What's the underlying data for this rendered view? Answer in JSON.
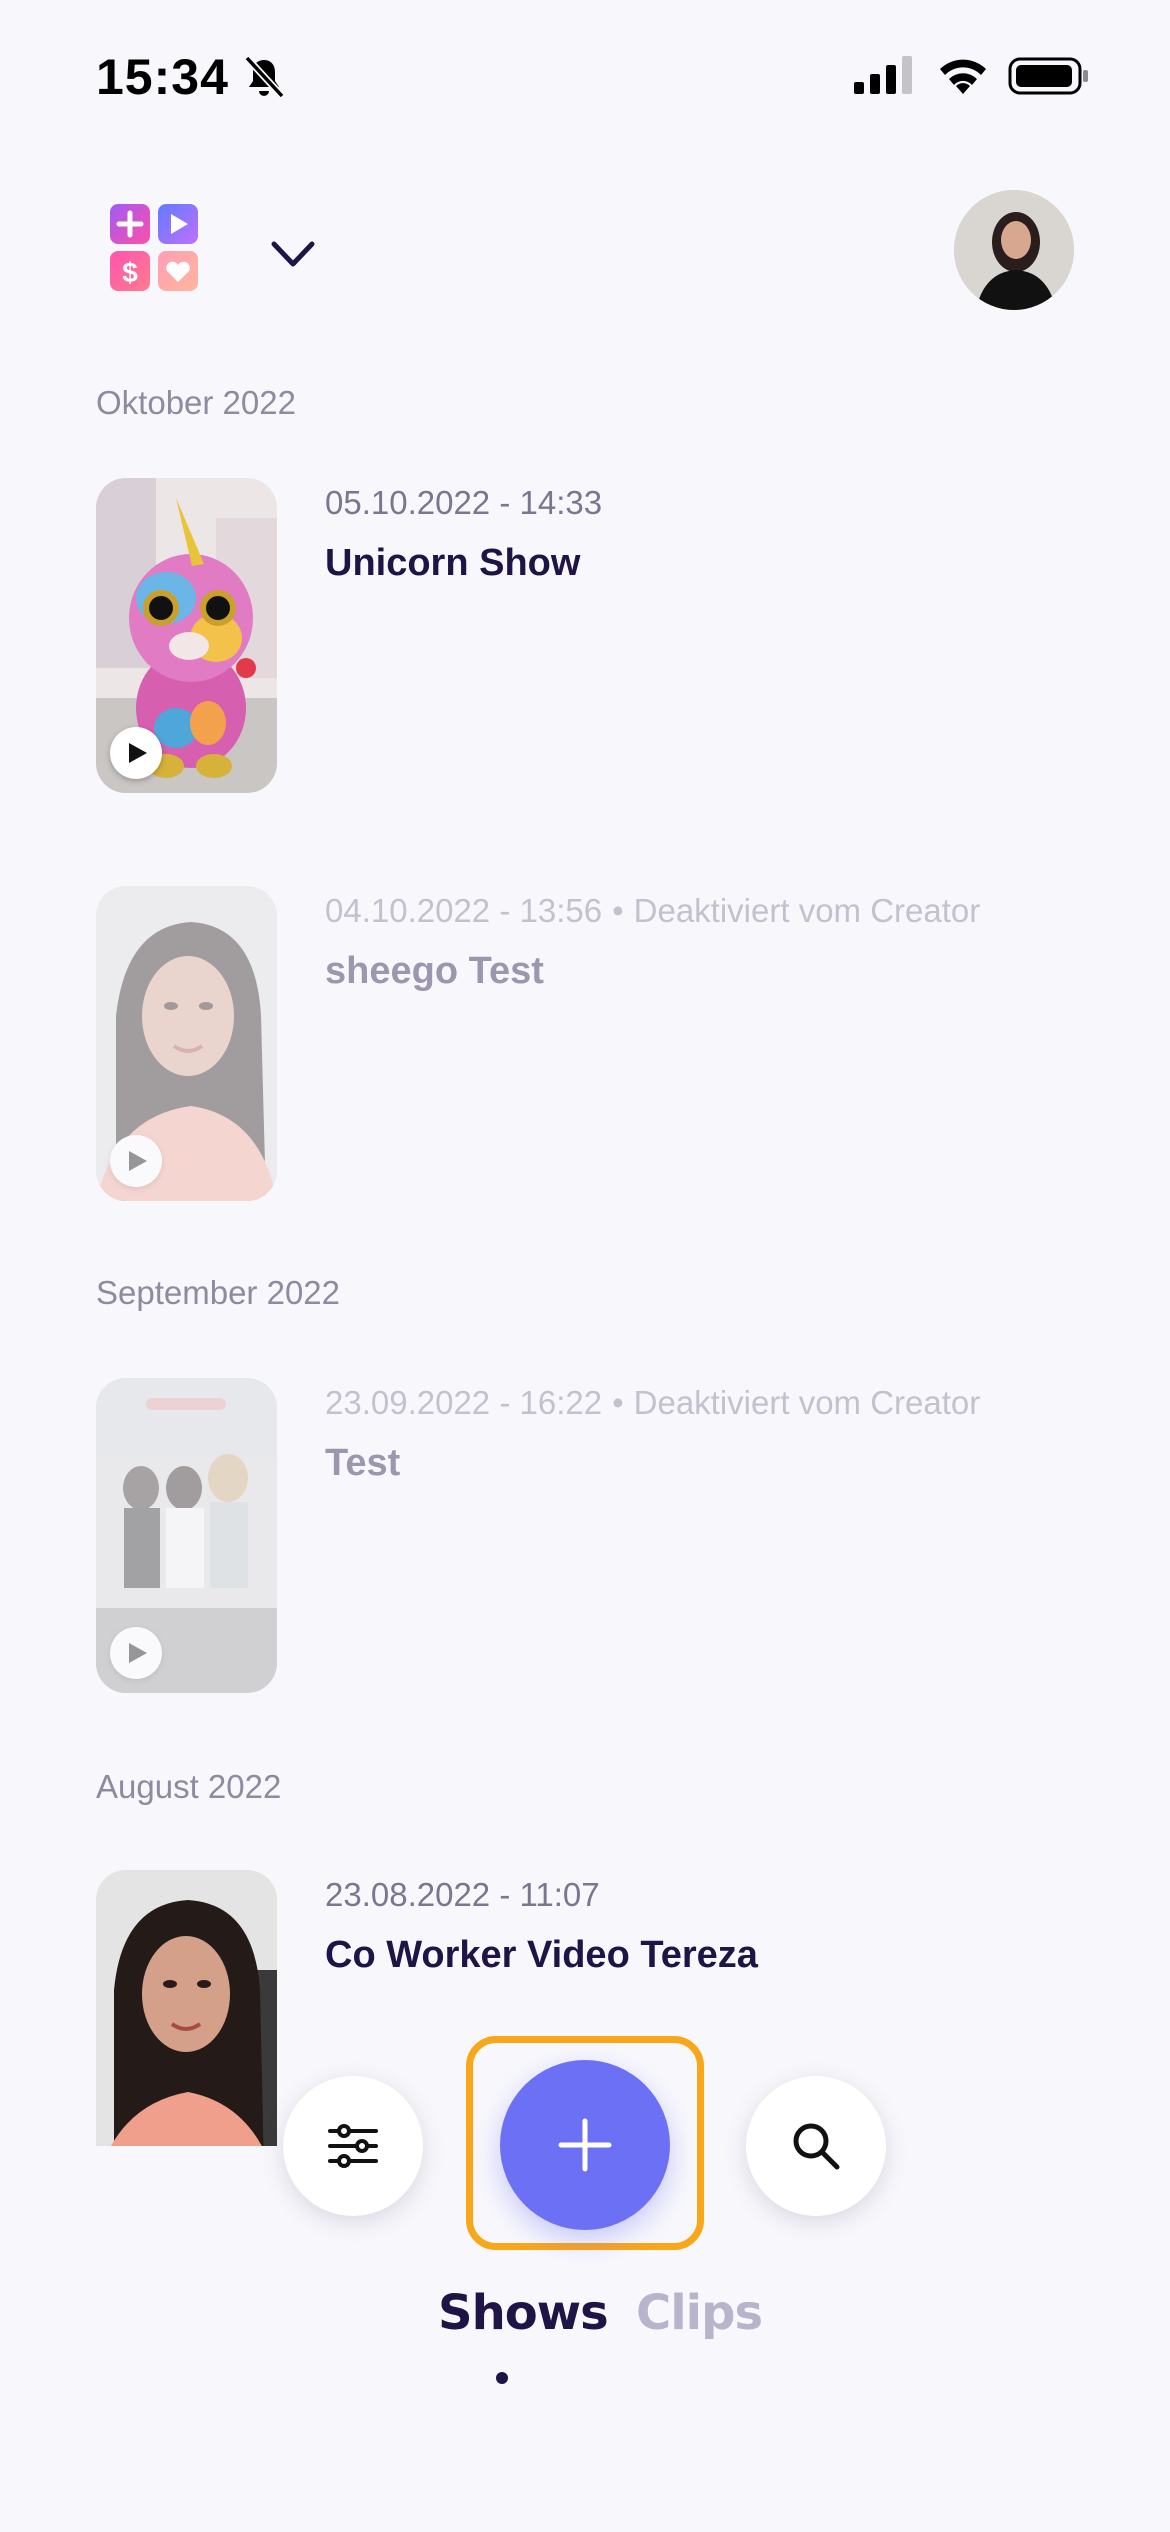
{
  "status_bar": {
    "time": "15:34"
  },
  "header": {
    "logo_icon": "app-logo-icon",
    "dropdown_icon": "chevron-down-icon",
    "avatar_icon": "profile-avatar"
  },
  "sections": [
    {
      "month": "Oktober 2022",
      "items": [
        {
          "datetime": "05.10.2022 - 14:33",
          "status": "",
          "title": "Unicorn Show",
          "disabled": false
        },
        {
          "datetime": "04.10.2022 - 13:56",
          "status": "Deaktiviert vom Creator",
          "title": "sheego Test",
          "disabled": true
        }
      ]
    },
    {
      "month": "September 2022",
      "items": [
        {
          "datetime": "23.09.2022 - 16:22",
          "status": "Deaktiviert vom Creator",
          "title": "Test",
          "disabled": true
        }
      ]
    },
    {
      "month": "August 2022",
      "items": [
        {
          "datetime": "23.08.2022 - 11:07",
          "status": "",
          "title": "Co Worker Video Tereza",
          "disabled": false
        }
      ]
    }
  ],
  "separator": "•",
  "bottom_bar": {
    "filter_icon": "sliders-icon",
    "add_icon": "plus-icon",
    "search_icon": "search-icon",
    "tabs": [
      {
        "label": "Shows",
        "active": true
      },
      {
        "label": "Clips",
        "active": false
      }
    ]
  },
  "colors": {
    "primary": "#6c70f5",
    "highlight": "#f8a61a",
    "text_dark": "#1e1446",
    "background": "#f8f8fc"
  }
}
